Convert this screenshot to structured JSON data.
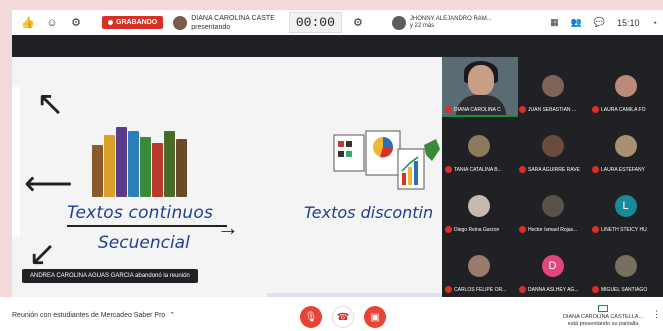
{
  "topbar": {
    "recording_label": "GRABANDO",
    "presenter_name": "DIANA CAROLINA CASTE",
    "presenter_status": "presentando",
    "timer": "00:00",
    "people_name": "JHONNY ALEJANDRO RAM...",
    "people_more": "y 22 más",
    "time": "15:10"
  },
  "slide": {
    "text_continuous": "Textos continuos",
    "text_sequential": "Secuencial",
    "text_discontinuous": "Textos discontin",
    "toast": "ANDREA CAROLINA AGUAS GARCIA abandonó la reunión"
  },
  "participants": [
    {
      "name": "DIANA CAROLINA C",
      "type": "self"
    },
    {
      "name": "JUAN SEBASTIAN ...",
      "color": "#7d6457"
    },
    {
      "name": "LAURA CAMILA FO",
      "color": "#b98b78"
    },
    {
      "name": "TANIA CATALINA B...",
      "color": "#8d7a5e"
    },
    {
      "name": "SARA AGUIRRE RAVE",
      "color": "#6a4b3d"
    },
    {
      "name": "LAURA ESTEFANY",
      "color": "#a89074"
    },
    {
      "name": "Diego Reina Garzon",
      "color": "#c7b9ad"
    },
    {
      "name": "Hector Ismael Rojas...",
      "color": "#5a5248"
    },
    {
      "name": "LINETH STEICY HU",
      "letter": "L",
      "color": "#1a8a9a"
    },
    {
      "name": "CARLOS FELIPE OR...",
      "color": "#9a7a6a"
    },
    {
      "name": "DANNA ASLHEY AG...",
      "letter": "D",
      "color": "#e0457b"
    },
    {
      "name": "MIGUEL SANTIAGO",
      "color": "#7a6f5e"
    }
  ],
  "bottombar": {
    "meeting_name": "Reunión con estudiantes de Mercadeo Saber Pro",
    "presenting_name": "DIANA CAROLINA CASTELLA...",
    "presenting_status": "está presentando su pantalla"
  },
  "colors": {
    "accent_red": "#ea4335",
    "title_blue": "#1f3f8f",
    "grid_bg": "#202124"
  }
}
